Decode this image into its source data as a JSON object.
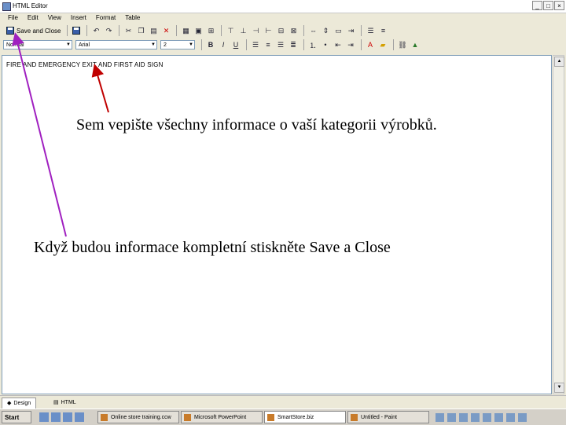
{
  "window": {
    "title": "HTML Editor",
    "controls": {
      "minimize": "_",
      "maximize": "□",
      "close": "×"
    }
  },
  "menu": [
    "File",
    "Edit",
    "View",
    "Insert",
    "Format",
    "Table"
  ],
  "toolbar": {
    "save_close_label": "Save and Close",
    "style_value": "Normal",
    "font_value": "Arial",
    "size_value": "2"
  },
  "editor": {
    "content": "FIRE AND EMERGENCY EXIT AND FIRST AID SIGN"
  },
  "view_tabs": [
    {
      "label": "Design"
    },
    {
      "label": "HTML"
    }
  ],
  "taskbar": {
    "start_label": "Start",
    "tasks": [
      {
        "label": "Online store training.ccw"
      },
      {
        "label": "Microsoft PowerPoint"
      },
      {
        "label": "SmartStore.biz"
      },
      {
        "label": "Untitled - Paint"
      }
    ]
  },
  "annotations": {
    "editor_hint": "Sem vepište všechny informace o vaší kategorii výrobků.",
    "save_hint": "Když budou informace kompletní stiskněte Save a Close"
  },
  "colors": {
    "arrow": "#c00000",
    "arrow_alt": "#a020c0",
    "chrome": "#ece9d8"
  }
}
